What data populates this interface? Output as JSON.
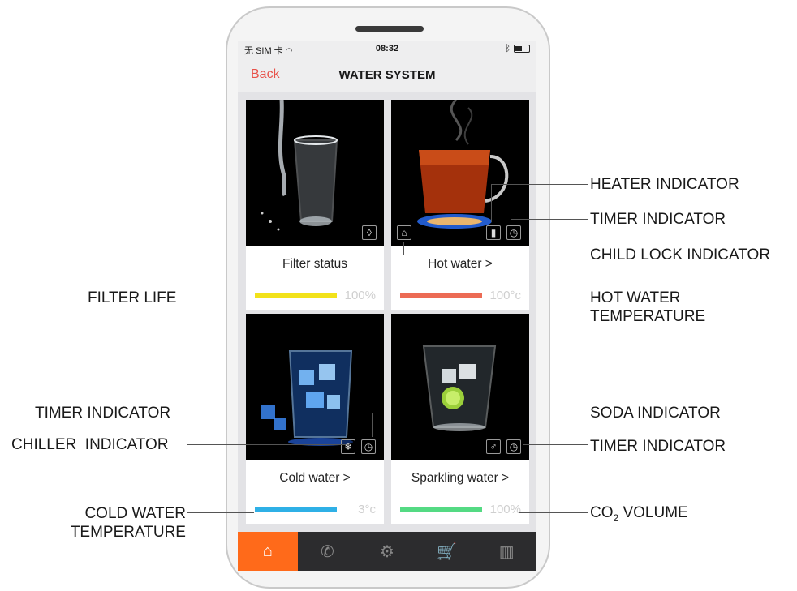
{
  "status_bar": {
    "carrier": "无 SIM 卡",
    "wifi_icon": "wifi-icon",
    "time": "08:32",
    "bluetooth_icon": "bluetooth-icon"
  },
  "nav": {
    "back_label": "Back",
    "title": "WATER SYSTEM"
  },
  "cards": {
    "filter": {
      "label": "Filter status",
      "value": "100%",
      "bar_color": "#f2e21a",
      "bar_fill": 1.0
    },
    "hot": {
      "label": "Hot water >",
      "value": "100°c",
      "bar_color": "#ec6b55",
      "bar_fill": 1.0
    },
    "cold": {
      "label": "Cold water >",
      "value": "3°c",
      "bar_color": "#2fb0e6",
      "bar_fill": 1.0
    },
    "sparkling": {
      "label": "Sparkling water >",
      "value": "100%",
      "bar_color": "#54da83",
      "bar_fill": 1.0
    }
  },
  "tabs": [
    {
      "icon": "home-icon",
      "glyph": "⌂",
      "active": true
    },
    {
      "icon": "phone-icon",
      "glyph": "✆",
      "active": false
    },
    {
      "icon": "settings-icon",
      "glyph": "⚙",
      "active": false
    },
    {
      "icon": "cart-icon",
      "glyph": "🛒",
      "active": false
    },
    {
      "icon": "stats-icon",
      "glyph": "▥",
      "active": false
    }
  ],
  "callouts": {
    "heater": "HEATER INDICATOR",
    "timer_hot": "TIMER INDICATOR",
    "child_lock": "CHILD LOCK INDICATOR",
    "filter_life": "FILTER LIFE",
    "hot_temp_1": "HOT WATER",
    "hot_temp_2": "TEMPERATURE",
    "timer_cold": "TIMER INDICATOR",
    "soda": "SODA INDICATOR",
    "chiller": "CHILLER  INDICATOR",
    "timer_soda": "TIMER INDICATOR",
    "cold_temp_1": "COLD WATER",
    "cold_temp_2": "TEMPERATURE",
    "co2": "CO",
    "co2_sub": "2",
    "co2_rest": " VOLUME"
  },
  "colors": {
    "accent": "#ff6a1a",
    "back": "#e8524a"
  }
}
